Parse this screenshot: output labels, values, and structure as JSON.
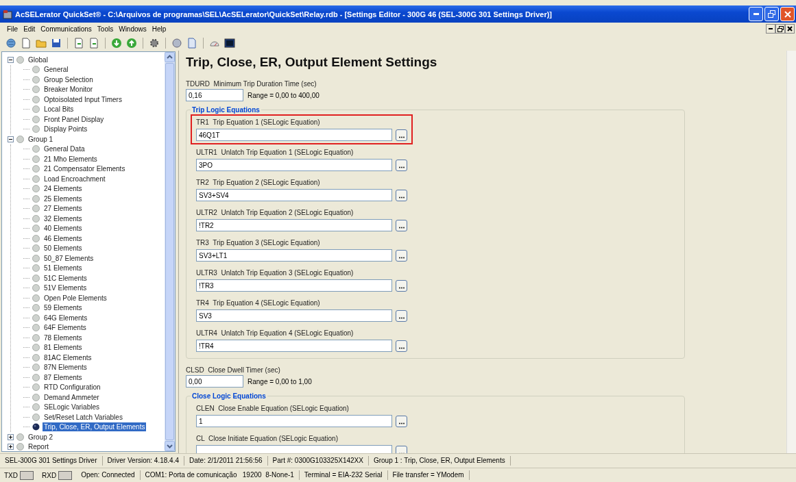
{
  "window": {
    "title": "AcSELerator QuickSet® - C:\\Arquivos de programas\\SEL\\AcSELerator\\QuickSet\\Relay.rdb - [Settings Editor - 300G 46 (SEL-300G 301 Settings Driver)]"
  },
  "menu": [
    "File",
    "Edit",
    "Communications",
    "Tools",
    "Windows",
    "Help"
  ],
  "tree": [
    {
      "label": "Global",
      "selected": false,
      "expanded": true,
      "children": [
        {
          "label": "General",
          "selected": false
        },
        {
          "label": "Group Selection",
          "selected": false
        },
        {
          "label": "Breaker Monitor",
          "selected": false
        },
        {
          "label": "Optoisolated Input Timers",
          "selected": false
        },
        {
          "label": "Local Bits",
          "selected": false
        },
        {
          "label": "Front Panel Display",
          "selected": false
        },
        {
          "label": "Display Points",
          "selected": false
        }
      ]
    },
    {
      "label": "Group 1",
      "selected": false,
      "expanded": true,
      "children": [
        {
          "label": "General Data",
          "selected": false
        },
        {
          "label": "21 Mho Elements",
          "selected": false
        },
        {
          "label": "21 Compensator Elements",
          "selected": false
        },
        {
          "label": "Load Encroachment",
          "selected": false
        },
        {
          "label": "24 Elements",
          "selected": false
        },
        {
          "label": "25 Elements",
          "selected": false
        },
        {
          "label": "27 Elements",
          "selected": false
        },
        {
          "label": "32 Elements",
          "selected": false
        },
        {
          "label": "40 Elements",
          "selected": false
        },
        {
          "label": "46 Elements",
          "selected": false
        },
        {
          "label": "50 Elements",
          "selected": false
        },
        {
          "label": "50_87 Elements",
          "selected": false
        },
        {
          "label": "51 Elements",
          "selected": false
        },
        {
          "label": "51C Elements",
          "selected": false
        },
        {
          "label": "51V Elements",
          "selected": false
        },
        {
          "label": "Open Pole Elements",
          "selected": false
        },
        {
          "label": "59 Elements",
          "selected": false
        },
        {
          "label": "64G Elements",
          "selected": false
        },
        {
          "label": "64F Elements",
          "selected": false
        },
        {
          "label": "78 Elements",
          "selected": false
        },
        {
          "label": "81 Elements",
          "selected": false
        },
        {
          "label": "81AC Elements",
          "selected": false
        },
        {
          "label": "87N Elements",
          "selected": false
        },
        {
          "label": "87 Elements",
          "selected": false
        },
        {
          "label": "RTD Configuration",
          "selected": false
        },
        {
          "label": "Demand Ammeter",
          "selected": false
        },
        {
          "label": "SELogic Variables",
          "selected": false
        },
        {
          "label": "Set/Reset Latch Variables",
          "selected": false
        },
        {
          "label": "Trip, Close, ER, Output Elements",
          "selected": true
        }
      ]
    },
    {
      "label": "Group 2",
      "selected": false,
      "expanded": false
    },
    {
      "label": "Report",
      "selected": false,
      "expanded": false
    }
  ],
  "editor": {
    "heading": "Trip, Close, ER, Output Element Settings",
    "sections": [
      {
        "kind": "numeric",
        "label": "TDURD  Minimum Trip Duration Time (sec)",
        "value": "0,16",
        "range": "Range = 0,00 to 400,00"
      },
      {
        "kind": "group",
        "title": "Trip Logic Equations",
        "fields": [
          {
            "label": "TR1  Trip Equation 1 (SELogic Equation)",
            "value": "46Q1T",
            "highlighted": true
          },
          {
            "label": "ULTR1  Unlatch Trip Equation 1 (SELogic Equation)",
            "value": "3PO",
            "highlighted": false
          },
          {
            "label": "TR2  Trip Equation 2 (SELogic Equation)",
            "value": "SV3+SV4",
            "highlighted": false
          },
          {
            "label": "ULTR2  Unlatch Trip Equation 2 (SELogic Equation)",
            "value": "!TR2",
            "highlighted": false
          },
          {
            "label": "TR3  Trip Equation 3 (SELogic Equation)",
            "value": "SV3+LT1",
            "highlighted": false
          },
          {
            "label": "ULTR3  Unlatch Trip Equation 3 (SELogic Equation)",
            "value": "!TR3",
            "highlighted": false
          },
          {
            "label": "TR4  Trip Equation 4 (SELogic Equation)",
            "value": "SV3",
            "highlighted": false
          },
          {
            "label": "ULTR4  Unlatch Trip Equation 4 (SELogic Equation)",
            "value": "!TR4",
            "highlighted": false
          }
        ]
      },
      {
        "kind": "numeric",
        "label": "CLSD  Close Dwell Timer (sec)",
        "value": "0,00",
        "range": "Range = 0,00 to 1,00"
      },
      {
        "kind": "group",
        "title": "Close Logic Equations",
        "fields": [
          {
            "label": "CLEN  Close Enable Equation (SELogic Equation)",
            "value": "1",
            "highlighted": false
          },
          {
            "label": "CL  Close Initiate Equation (SELogic Equation)",
            "highlighted": false
          }
        ]
      }
    ]
  },
  "status_bar": [
    "SEL-300G 301 Settings Driver",
    "Driver Version: 4.18.4.4",
    "Date: 2/1/2011 21:56:56",
    "Part #: 0300G103325X142XX",
    "Group 1 : Trip, Close, ER, Output Elements"
  ],
  "comm_bar": {
    "indicators": [
      "TXD",
      "RXD"
    ],
    "fields": [
      "Open: Connected",
      "COM1: Porta de comunicação   19200  8-None-1",
      "Terminal = EIA-232 Serial",
      "File transfer = YModem"
    ]
  }
}
